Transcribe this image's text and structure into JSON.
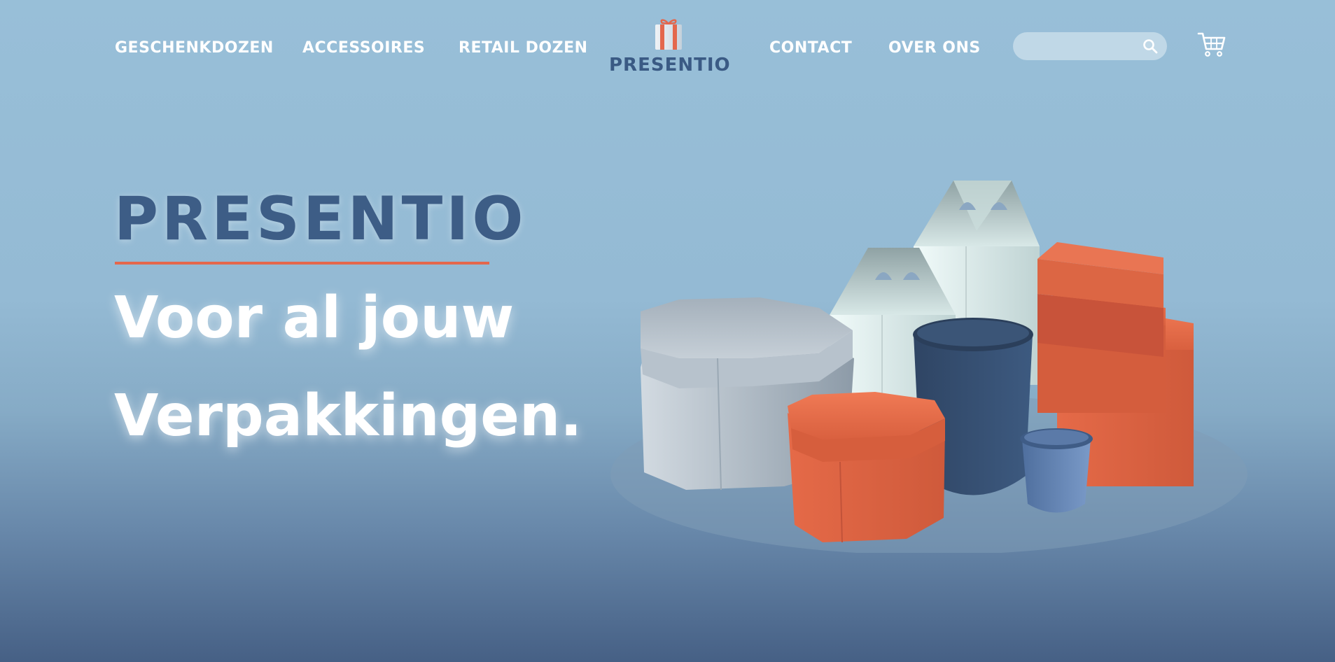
{
  "nav": {
    "left_links": [
      "GESCHENKDOZEN",
      "ACCESSOIRES",
      "RETAIL DOZEN"
    ],
    "right_links": [
      "CONTACT",
      "OVER ONS"
    ]
  },
  "logo": {
    "text": "PRESENTIO",
    "icon": "gift-box-icon"
  },
  "search": {
    "placeholder": "",
    "value": "",
    "icon": "search-icon"
  },
  "cart": {
    "icon": "shopping-cart-icon"
  },
  "hero": {
    "brand": "PRESENTIO",
    "line1": "Voor al jouw",
    "line2": "Verpakkingen."
  },
  "illustration": {
    "icon": "packaging-boxes-illustration"
  },
  "colors": {
    "brand_navy": "#3d5d86",
    "accent_orange": "#e4674c",
    "background_top": "#98bfd8",
    "background_bottom": "#466085",
    "text_white": "#ffffff"
  }
}
